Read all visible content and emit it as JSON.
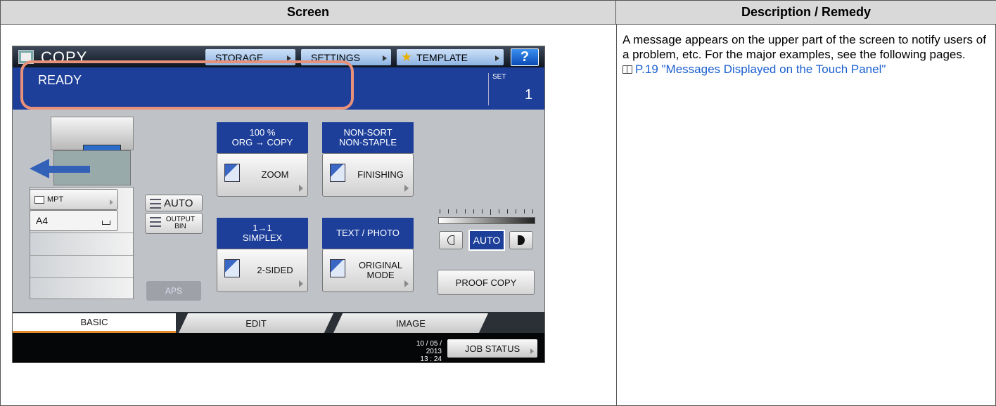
{
  "table": {
    "header_screen": "Screen",
    "header_description": "Description / Remedy",
    "description": "A message appears on the upper part of the screen to notify users of a problem, etc. For the major examples, see the following pages.",
    "link_text": "P.19 \"Messages Displayed on the Touch Panel\""
  },
  "panel": {
    "title": "COPY",
    "top_buttons": [
      "STORAGE",
      "SETTINGS",
      "TEMPLATE"
    ],
    "help_label": "?",
    "message": "READY",
    "set_label": "SET",
    "set_value": "1",
    "tray_mpt": "MPT",
    "tray_a4": "A4",
    "auto_label": "AUTO",
    "output_bin_line1": "OUTPUT",
    "output_bin_line2": "BIN",
    "aps_label": "APS",
    "zoom_caption_line1": "100 %",
    "zoom_caption_line2": "ORG → COPY",
    "zoom_label": "ZOOM",
    "finishing_caption_line1": "NON-SORT",
    "finishing_caption_line2": "NON-STAPLE",
    "finishing_label": "FINISHING",
    "sided_caption_line1": "1→1",
    "sided_caption_line2": "SIMPLEX",
    "sided_label": "2-SIDED",
    "original_caption": "TEXT / PHOTO",
    "original_label_line1": "ORIGINAL",
    "original_label_line2": "MODE",
    "density_auto": "AUTO",
    "proof_copy": "PROOF COPY",
    "tabs": [
      "BASIC",
      "EDIT",
      "IMAGE"
    ],
    "date": "10 / 05 / 2013",
    "time": "13 : 24",
    "job_status": "JOB STATUS",
    "accent_color": "#1d3f9a",
    "highlight_color": "#e8917a"
  }
}
